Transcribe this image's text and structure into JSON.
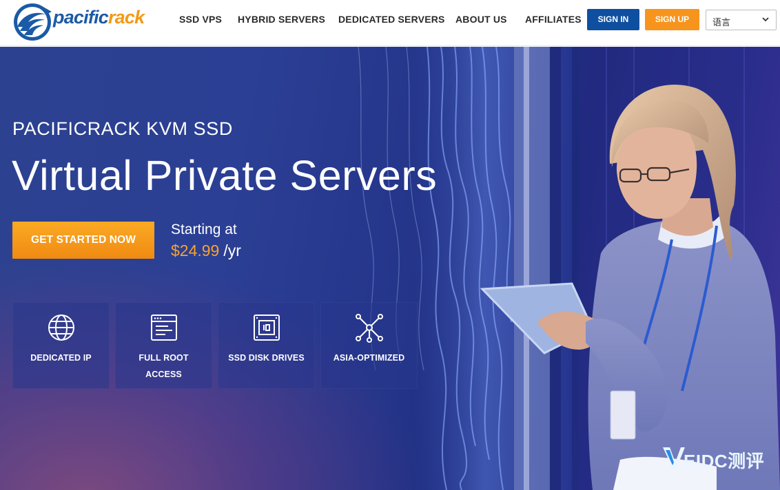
{
  "brand": {
    "logo_text_part1": "pacific",
    "logo_text_part2": "rack",
    "colors": {
      "primary_blue": "#0f4fa0",
      "accent_orange": "#f7941d",
      "price_orange": "#f9a22b"
    }
  },
  "nav": {
    "items": [
      {
        "label": "SSD VPS"
      },
      {
        "label": "HYBRID SERVERS"
      },
      {
        "label": "DEDICATED SERVERS"
      },
      {
        "label": "ABOUT US"
      },
      {
        "label": "AFFILIATES"
      }
    ],
    "signin_label": "SIGN IN",
    "signup_label": "SIGN UP",
    "language": {
      "selected": "语言",
      "icon": "chevron-down-icon"
    }
  },
  "hero": {
    "subtitle": "PACIFICRACK KVM SSD",
    "title": "Virtual Private Servers",
    "cta_label": "GET STARTED NOW",
    "price_prefix": "Starting at",
    "price_amount": "$24.99",
    "price_unit": "/yr",
    "features": [
      {
        "label": "DEDICATED IP",
        "icon": "globe-icon"
      },
      {
        "label": "FULL ROOT ACCESS",
        "icon": "terminal-window-icon"
      },
      {
        "label": "SSD DISK DRIVES",
        "icon": "ssd-drive-icon"
      },
      {
        "label": "ASIA-OPTIMIZED",
        "icon": "network-nodes-icon"
      }
    ]
  },
  "watermark": {
    "text": "EIDC测评"
  }
}
